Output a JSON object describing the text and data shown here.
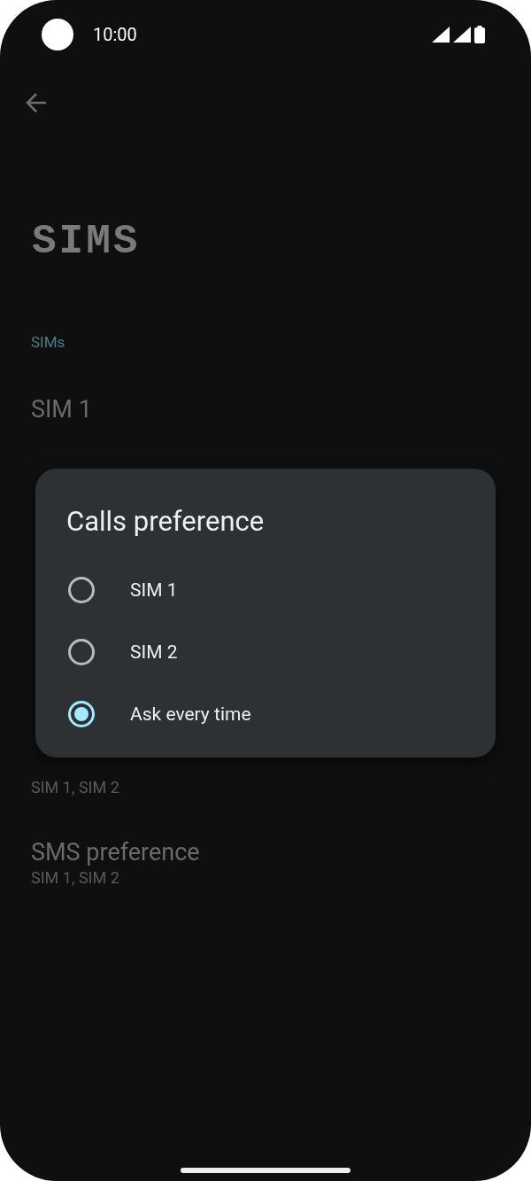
{
  "status_bar": {
    "time": "10:00"
  },
  "page": {
    "title": "SIMS",
    "section_header": "SIMs",
    "rows": [
      {
        "title": "SIM 1"
      },
      {
        "subtitle": "SIM 1, SIM 2"
      },
      {
        "title": "SMS preference",
        "subtitle": "SIM 1, SIM 2"
      }
    ]
  },
  "dialog": {
    "title": "Calls preference",
    "options": [
      {
        "label": "SIM 1",
        "selected": false
      },
      {
        "label": "SIM 2",
        "selected": false
      },
      {
        "label": "Ask every time",
        "selected": true
      }
    ]
  }
}
